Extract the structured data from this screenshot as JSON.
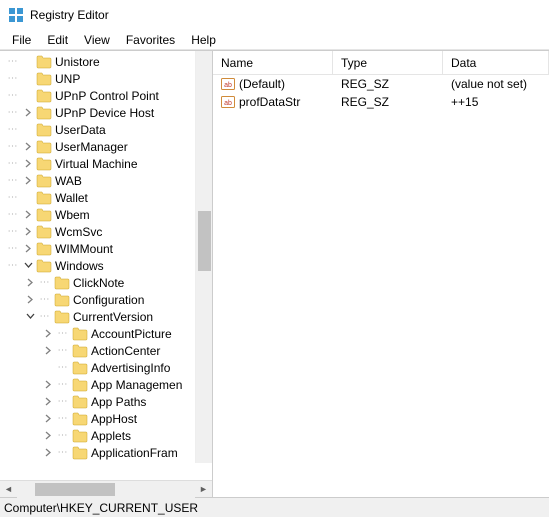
{
  "window": {
    "title": "Registry Editor"
  },
  "menubar": {
    "items": [
      "File",
      "Edit",
      "View",
      "Favorites",
      "Help"
    ]
  },
  "tree": {
    "nodes": [
      {
        "label": "Unistore",
        "depth": 2,
        "expander": "blank"
      },
      {
        "label": "UNP",
        "depth": 2,
        "expander": "blank"
      },
      {
        "label": "UPnP Control Point",
        "depth": 2,
        "expander": "blank"
      },
      {
        "label": "UPnP Device Host",
        "depth": 2,
        "expander": "closed"
      },
      {
        "label": "UserData",
        "depth": 2,
        "expander": "blank"
      },
      {
        "label": "UserManager",
        "depth": 2,
        "expander": "closed"
      },
      {
        "label": "Virtual Machine",
        "depth": 2,
        "expander": "closed"
      },
      {
        "label": "WAB",
        "depth": 2,
        "expander": "closed"
      },
      {
        "label": "Wallet",
        "depth": 2,
        "expander": "blank"
      },
      {
        "label": "Wbem",
        "depth": 2,
        "expander": "closed"
      },
      {
        "label": "WcmSvc",
        "depth": 2,
        "expander": "closed"
      },
      {
        "label": "WIMMount",
        "depth": 2,
        "expander": "closed"
      },
      {
        "label": "Windows",
        "depth": 2,
        "expander": "open"
      },
      {
        "label": "ClickNote",
        "depth": 3,
        "expander": "closed"
      },
      {
        "label": "Configuration",
        "depth": 3,
        "expander": "closed"
      },
      {
        "label": "CurrentVersion",
        "depth": 3,
        "expander": "open"
      },
      {
        "label": "AccountPicture",
        "depth": 4,
        "expander": "closed"
      },
      {
        "label": "ActionCenter",
        "depth": 4,
        "expander": "closed"
      },
      {
        "label": "AdvertisingInfo",
        "depth": 4,
        "expander": "blank"
      },
      {
        "label": "App Managemen",
        "depth": 4,
        "expander": "closed"
      },
      {
        "label": "App Paths",
        "depth": 4,
        "expander": "closed"
      },
      {
        "label": "AppHost",
        "depth": 4,
        "expander": "closed"
      },
      {
        "label": "Applets",
        "depth": 4,
        "expander": "closed"
      },
      {
        "label": "ApplicationFram",
        "depth": 4,
        "expander": "closed"
      }
    ]
  },
  "list": {
    "columns": {
      "name": "Name",
      "type": "Type",
      "data": "Data"
    },
    "rows": [
      {
        "name": "(Default)",
        "type": "REG_SZ",
        "data": "(value not set)"
      },
      {
        "name": "profDataStr",
        "type": "REG_SZ",
        "data": "++15"
      }
    ]
  },
  "statusbar": {
    "path": "Computer\\HKEY_CURRENT_USER"
  }
}
